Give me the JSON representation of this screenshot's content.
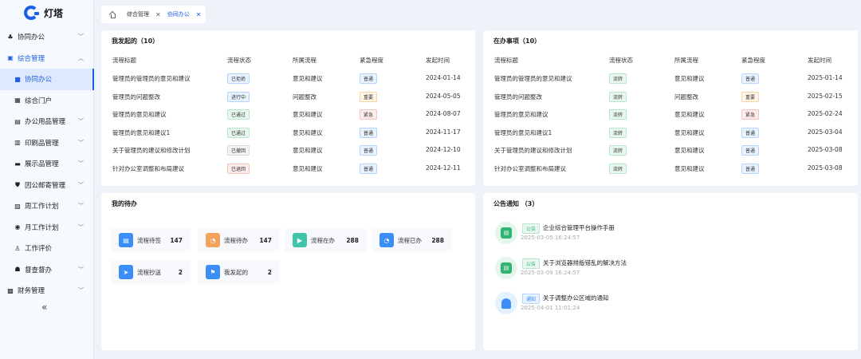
{
  "app": {
    "logo_text": "灯塔"
  },
  "sidebar": {
    "items": [
      {
        "label": "协同办公",
        "icon": "apps-icon",
        "level": "top",
        "state": "collapsed"
      },
      {
        "label": "综合管理",
        "icon": "grid-icon",
        "level": "top",
        "state": "expanded"
      },
      {
        "label": "协同办公",
        "icon": "square-icon",
        "level": "sub",
        "state": "selected"
      },
      {
        "label": "综合门户",
        "icon": "blocks-icon",
        "level": "sub",
        "state": "normal"
      },
      {
        "label": "办公用品管理",
        "icon": "briefcase-icon",
        "level": "sub",
        "state": "collapsed"
      },
      {
        "label": "印刷品管理",
        "icon": "print-icon",
        "level": "sub",
        "state": "collapsed"
      },
      {
        "label": "展示品管理",
        "icon": "display-icon",
        "level": "sub",
        "state": "collapsed"
      },
      {
        "label": "因公邮寄管理",
        "icon": "shield-icon",
        "level": "sub",
        "state": "collapsed"
      },
      {
        "label": "周工作计划",
        "icon": "calendar-icon",
        "level": "sub",
        "state": "collapsed"
      },
      {
        "label": "月工作计划",
        "icon": "location-icon",
        "level": "sub",
        "state": "collapsed"
      },
      {
        "label": "工作评价",
        "icon": "user-icon",
        "level": "sub",
        "state": "normal"
      },
      {
        "label": "督查督办",
        "icon": "users-icon",
        "level": "sub",
        "state": "collapsed"
      },
      {
        "label": "财务管理",
        "icon": "wallet-icon",
        "level": "top",
        "state": "collapsed"
      }
    ],
    "collapse_label": "«"
  },
  "tabs": [
    {
      "label": "综合管理",
      "active": false
    },
    {
      "label": "协同办公",
      "active": true
    }
  ],
  "initiated": {
    "title": "我发起的（10）",
    "columns": [
      "流程标题",
      "流程状态",
      "所属流程",
      "紧急程度",
      "发起时间"
    ],
    "rows": [
      {
        "title": "管理员的管理员的意见和建议",
        "status": "已拒绝",
        "status_color": "blue",
        "flow": "意见和建议",
        "urgency": "普通",
        "urgency_color": "blue",
        "time": "2024-01-14"
      },
      {
        "title": "管理员的问题整改",
        "status": "进行中",
        "status_color": "blue",
        "flow": "问题整改",
        "urgency": "重要",
        "urgency_color": "orange",
        "time": "2024-05-05"
      },
      {
        "title": "管理员的意见和建议",
        "status": "已通过",
        "status_color": "green",
        "flow": "意见和建议",
        "urgency": "紧急",
        "urgency_color": "red",
        "time": "2024-08-07"
      },
      {
        "title": "管理员的意见和建议1",
        "status": "已通过",
        "status_color": "green",
        "flow": "意见和建议",
        "urgency": "普通",
        "urgency_color": "blue",
        "time": "2024-11-17"
      },
      {
        "title": "关于管理员的建议和修改计划",
        "status": "已撤回",
        "status_color": "gray",
        "flow": "意见和建议",
        "urgency": "普通",
        "urgency_color": "blue",
        "time": "2024-12-10"
      },
      {
        "title": "针对办公室调整和布局建议",
        "status": "已退回",
        "status_color": "red",
        "flow": "意见和建议",
        "urgency": "普通",
        "urgency_color": "blue",
        "time": "2024-12-11"
      }
    ]
  },
  "pending": {
    "title": "在办事项（10）",
    "columns": [
      "流程标题",
      "流程状态",
      "所属流程",
      "紧急程度",
      "发起时间"
    ],
    "rows": [
      {
        "title": "管理员的管理员的意见和建议",
        "status": "流转",
        "status_color": "green",
        "flow": "意见和建议",
        "urgency": "普通",
        "urgency_color": "blue",
        "time": "2025-01-14"
      },
      {
        "title": "管理员的问题整改",
        "status": "流转",
        "status_color": "green",
        "flow": "问题整改",
        "urgency": "重要",
        "urgency_color": "orange",
        "time": "2025-02-15"
      },
      {
        "title": "管理员的意见和建议",
        "status": "流转",
        "status_color": "green",
        "flow": "意见和建议",
        "urgency": "紧急",
        "urgency_color": "red",
        "time": "2025-02-24"
      },
      {
        "title": "管理员的意见和建议1",
        "status": "流转",
        "status_color": "green",
        "flow": "意见和建议",
        "urgency": "普通",
        "urgency_color": "blue",
        "time": "2025-03-04"
      },
      {
        "title": "关于管理员的建议和修改计划",
        "status": "流转",
        "status_color": "green",
        "flow": "意见和建议",
        "urgency": "普通",
        "urgency_color": "blue",
        "time": "2025-03-08"
      },
      {
        "title": "针对办公室调整和布局建议",
        "status": "流转",
        "status_color": "green",
        "flow": "意见和建议",
        "urgency": "普通",
        "urgency_color": "blue",
        "time": "2025-03-08"
      }
    ]
  },
  "todo": {
    "title": "我的待办",
    "items": [
      {
        "label": "流程待签",
        "count": "147",
        "icon": "document-icon",
        "color": "#3b8ef5"
      },
      {
        "label": "流程待办",
        "count": "147",
        "icon": "clock-icon",
        "color": "#f3a25b"
      },
      {
        "label": "流程在办",
        "count": "288",
        "icon": "play-icon",
        "color": "#3fc6a8"
      },
      {
        "label": "流程已办",
        "count": "288",
        "icon": "clock-icon",
        "color": "#3b8ef5"
      },
      {
        "label": "流程抄送",
        "count": "2",
        "icon": "send-icon",
        "color": "#3b8ef5"
      },
      {
        "label": "我发起的",
        "count": "2",
        "icon": "flag-icon",
        "color": "#3b8ef5"
      }
    ]
  },
  "notices": {
    "title": "公告通知 （3）",
    "items": [
      {
        "tag": "公告",
        "tag_color": "green",
        "title": "企业综合管理平台操作手册",
        "date": "2025-03-05 16:24:57",
        "icon": "notice-doc-icon"
      },
      {
        "tag": "公告",
        "tag_color": "green",
        "title": "关于浏览器排版错乱的解决方法",
        "date": "2025-03-09 16:24:57",
        "icon": "notice-doc-icon"
      },
      {
        "tag": "通知",
        "tag_color": "blue",
        "title": "关于调整办公区域的通知",
        "date": "2025-04-01 11:01:24",
        "icon": "bell-icon"
      }
    ]
  },
  "colors": {
    "accent": "#1d5fe6",
    "page_bg": "#eef3fa"
  }
}
